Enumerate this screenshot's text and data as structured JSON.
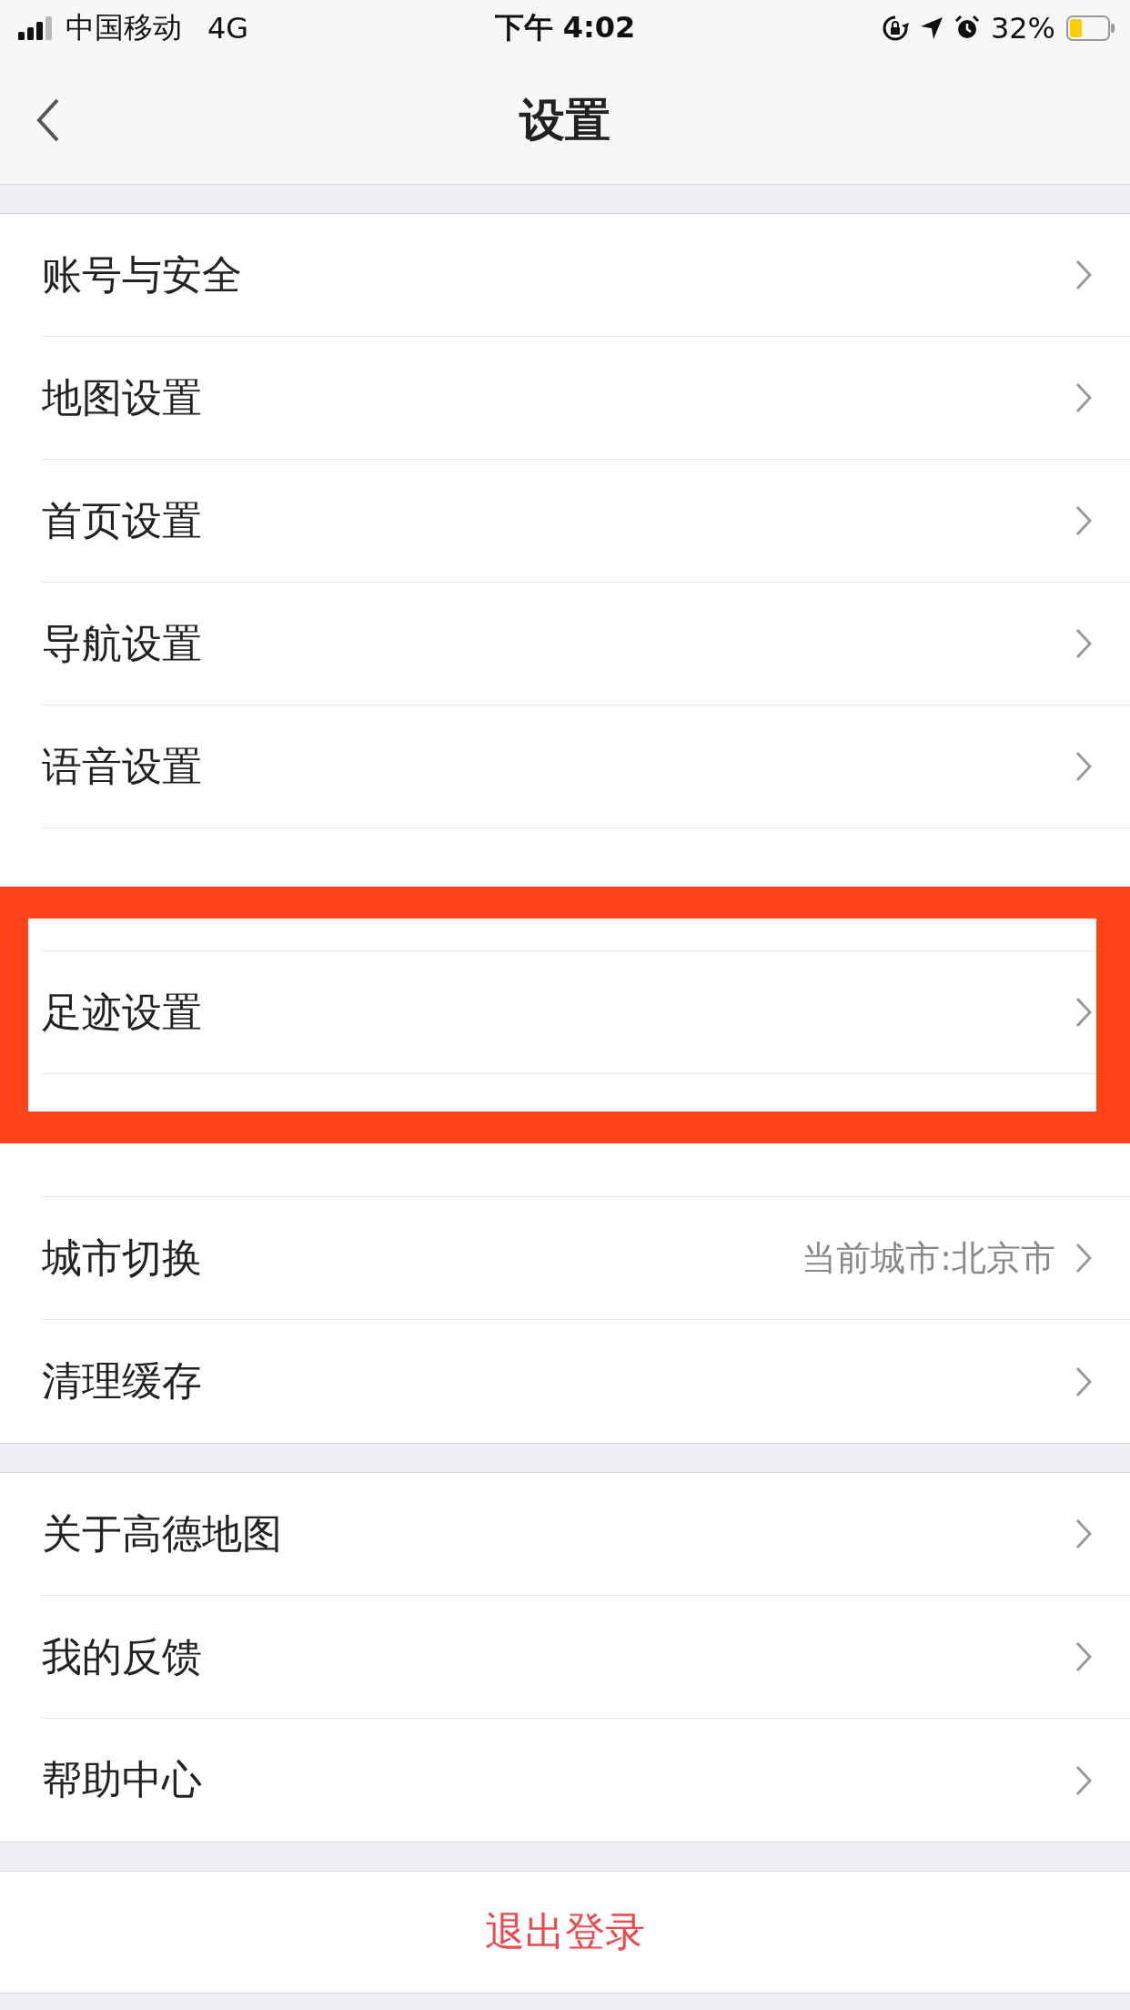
{
  "status_bar": {
    "carrier": "中国移动",
    "network": "4G",
    "time": "下午 4:02",
    "battery": "32%"
  },
  "title": "设置",
  "groups": [
    {
      "items": [
        {
          "label": "账号与安全",
          "highlighted": false
        },
        {
          "label": "地图设置",
          "highlighted": false
        },
        {
          "label": "首页设置",
          "highlighted": false
        },
        {
          "label": "导航设置",
          "highlighted": false
        },
        {
          "label": "语音设置",
          "highlighted": false
        },
        {
          "obscured": true,
          "highlighted": false
        },
        {
          "label": "足迹设置",
          "highlighted": true
        },
        {
          "obscured": true,
          "highlighted": false
        },
        {
          "label": "城市切换",
          "value": "当前城市:北京市",
          "highlighted": false
        },
        {
          "label": "清理缓存",
          "highlighted": false
        }
      ]
    },
    {
      "items": [
        {
          "label": "关于高德地图",
          "highlighted": false
        },
        {
          "label": "我的反馈",
          "highlighted": false
        },
        {
          "label": "帮助中心",
          "highlighted": false
        }
      ]
    }
  ],
  "logout": "退出登录"
}
